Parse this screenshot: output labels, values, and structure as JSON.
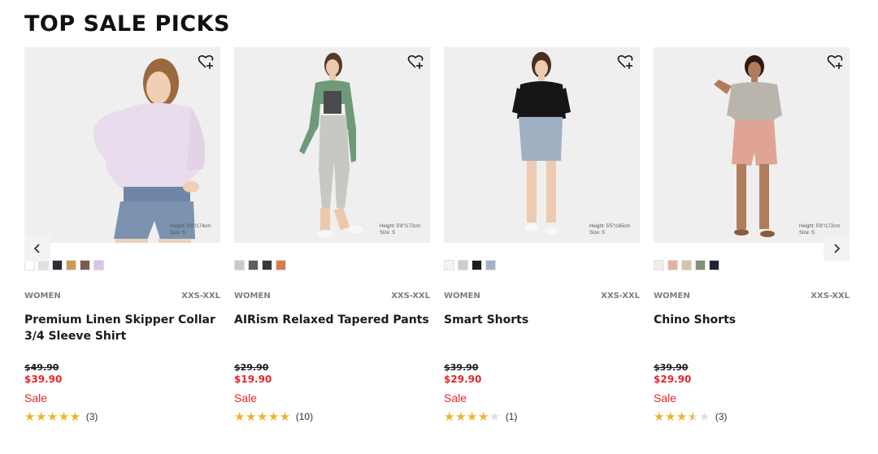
{
  "section": {
    "title": "TOP SALE PICKS"
  },
  "colors": {
    "sale_red": "#e5262d",
    "star_gold": "#f0b429",
    "star_empty": "#dedede"
  },
  "products": [
    {
      "gender": "WOMEN",
      "sizes": "XXS-XXL",
      "name": "Premium Linen Skipper Collar 3/4 Sleeve Shirt",
      "original_price": "$49.90",
      "sale_price": "$39.90",
      "flag": "Sale",
      "rating": 5,
      "reviews": "(3)",
      "model_height": "Height: 5'9\"/174cm",
      "model_size": "Size: S",
      "swatches": [
        "#ffffff",
        "#e4dde6",
        "#2a2d3a",
        "#c99a5a",
        "#7a5b4f",
        "#d9c3e6"
      ]
    },
    {
      "gender": "WOMEN",
      "sizes": "XXS-XXL",
      "name": "AIRism Relaxed Tapered Pants",
      "original_price": "$29.90",
      "sale_price": "$19.90",
      "flag": "Sale",
      "rating": 5,
      "reviews": "(10)",
      "model_height": "Height: 5'8\"/172cm",
      "model_size": "Size: S",
      "swatches": [
        "#c9c9c9",
        "#5d5f61",
        "#38393b",
        "#d87a4c"
      ]
    },
    {
      "gender": "WOMEN",
      "sizes": "XXS-XXL",
      "name": "Smart Shorts",
      "original_price": "$39.90",
      "sale_price": "$29.90",
      "flag": "Sale",
      "rating": 4,
      "reviews": "(1)",
      "model_height": "Height: 5'5\"/165cm",
      "model_size": "Size: S",
      "swatches": [
        "#f3f3f3",
        "#cbcdd0",
        "#1e1e1e",
        "#a3b3c8"
      ]
    },
    {
      "gender": "WOMEN",
      "sizes": "XXS-XXL",
      "name": "Chino Shorts",
      "original_price": "$39.90",
      "sale_price": "$29.90",
      "flag": "Sale",
      "rating": 3.5,
      "reviews": "(3)",
      "model_height": "Height: 5'8\"/172cm",
      "model_size": "Size: S",
      "swatches": [
        "#f1ede6",
        "#e4b0a6",
        "#d6c4a8",
        "#7e9277",
        "#1f2536"
      ]
    }
  ],
  "icons": {
    "favorite": "heart-plus-icon",
    "prev": "chevron-left-icon",
    "next": "chevron-right-icon",
    "star": "star-icon"
  }
}
